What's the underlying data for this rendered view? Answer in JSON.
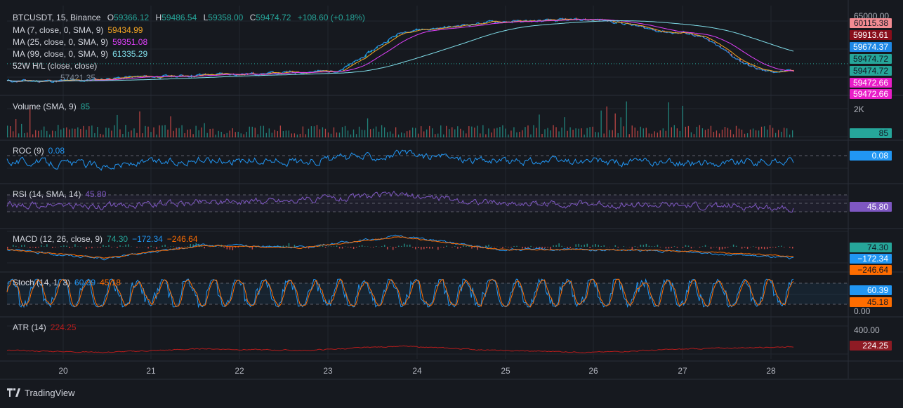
{
  "header": {
    "symbol": "BTCUSDT",
    "interval": "15",
    "exchange": "Binance",
    "open_label": "O",
    "open": "59366.12",
    "high_label": "H",
    "high": "59486.54",
    "low_label": "L",
    "low": "59358.00",
    "close_label": "C",
    "close": "59474.72",
    "change": "+108.60 (+0.18%)"
  },
  "overlays": [
    {
      "label": "MA (7, close, 0, SMA, 9)",
      "value": "59434.99",
      "color": "#f5a623"
    },
    {
      "label": "MA (25, close, 0, SMA, 9)",
      "value": "59351.08",
      "color": "#e040fb"
    },
    {
      "label": "MA (99, close, 0, SMA, 9)",
      "value": "61335.29",
      "color": "#80deea"
    },
    {
      "label": "52W H/L (close, close)",
      "value": "",
      "color": "#d1d4dc"
    }
  ],
  "overlay_partial_value": "57421.35",
  "price_axis": {
    "top_tick": "65000.00",
    "badges": [
      {
        "value": "60115.38",
        "bg": "#f28b92",
        "fg": "#131722"
      },
      {
        "value": "59913.61",
        "bg": "#880e1b",
        "fg": "#ffffff"
      },
      {
        "value": "59674.37",
        "bg": "#1e88e5",
        "fg": "#ffffff"
      },
      {
        "value": "59474.72",
        "bg": "#26a69a",
        "fg": "#131722"
      },
      {
        "value": "59474.72",
        "bg": "#26a69a",
        "fg": "#131722"
      },
      {
        "value": "59472.66",
        "bg": "#e91ec8",
        "fg": "#ffffff"
      },
      {
        "value": "59472.66",
        "bg": "#e91ec8",
        "fg": "#ffffff"
      }
    ]
  },
  "panes": {
    "volume": {
      "label": "Volume (SMA, 9)",
      "value": "85",
      "value_color": "#26a69a",
      "axis_tick": "2K",
      "badge": "85",
      "badge_bg": "#26a69a"
    },
    "roc": {
      "label": "ROC (9)",
      "value": "0.08",
      "value_color": "#2962ff",
      "badge": "0.08",
      "badge_bg": "#2196f3"
    },
    "rsi": {
      "label": "RSI (14, SMA, 14)",
      "value": "45.80",
      "value_color": "#7e57c2",
      "badge": "45.80",
      "badge_bg": "#7e57c2"
    },
    "macd": {
      "label": "MACD (12, 26, close, 9)",
      "v1": "74.30",
      "v2": "−172.34",
      "v3": "−246.64",
      "badges": [
        {
          "value": "74.30",
          "bg": "#26a69a"
        },
        {
          "value": "−172.34",
          "bg": "#2196f3"
        },
        {
          "value": "−246.64",
          "bg": "#ff6d00"
        }
      ]
    },
    "stoch": {
      "label": "Stoch (14, 1, 3)",
      "v1": "60.39",
      "v2": "45.18",
      "axis_tick": "0.00",
      "badges": [
        {
          "value": "60.39",
          "bg": "#2196f3"
        },
        {
          "value": "45.18",
          "bg": "#ff6d00"
        }
      ]
    },
    "atr": {
      "label": "ATR (14)",
      "value": "224.25",
      "axis_tick": "400.00",
      "badge": "224.25",
      "badge_bg": "#8e1b24"
    }
  },
  "time_axis": [
    "20",
    "21",
    "22",
    "23",
    "24",
    "25",
    "26",
    "27",
    "28"
  ],
  "footer": {
    "brand": "TradingView"
  },
  "colors": {
    "background": "#16191f",
    "grid": "#22262f",
    "up": "#26a69a",
    "down": "#ef5350",
    "roc": "#2196f3",
    "rsi": "#7e57c2",
    "macd": "#2196f3",
    "signal": "#ff6d00",
    "atr": "#b71c1c"
  },
  "chart_data": {
    "type": "line",
    "title": "BTCUSDT, 15, Binance",
    "x": [
      "20",
      "21",
      "22",
      "23",
      "24",
      "25",
      "26",
      "27",
      "28"
    ],
    "ylim": [
      56500,
      65000
    ],
    "series": [
      {
        "name": "BTCUSDT",
        "values": [
          57500,
          58000,
          58300,
          58600,
          63400,
          64300,
          64500,
          63000,
          58600
        ]
      },
      {
        "name": "MA (7, close, 0, SMA, 9)",
        "values": [
          57600,
          58000,
          58350,
          58700,
          63300,
          64300,
          64400,
          63100,
          59435
        ]
      },
      {
        "name": "MA (25, close, 0, SMA, 9)",
        "values": [
          57700,
          57950,
          58300,
          58700,
          63000,
          64200,
          64400,
          63300,
          59351
        ]
      },
      {
        "name": "MA (99, close, 0, SMA, 9)",
        "values": [
          57900,
          57900,
          58200,
          58600,
          62200,
          64000,
          64300,
          63600,
          61335
        ]
      },
      {
        "name": "ROC (9)",
        "values": [
          0.2,
          -0.5,
          0.3,
          0.1,
          1.1,
          0.1,
          0.0,
          -0.2,
          0.08
        ]
      },
      {
        "name": "RSI (14, SMA, 14)",
        "values": [
          50,
          47,
          55,
          58,
          66,
          52,
          51,
          47,
          45.8
        ]
      },
      {
        "name": "ATR (14)",
        "values": [
          180,
          160,
          200,
          180,
          230,
          180,
          160,
          200,
          224.25
        ]
      }
    ]
  }
}
